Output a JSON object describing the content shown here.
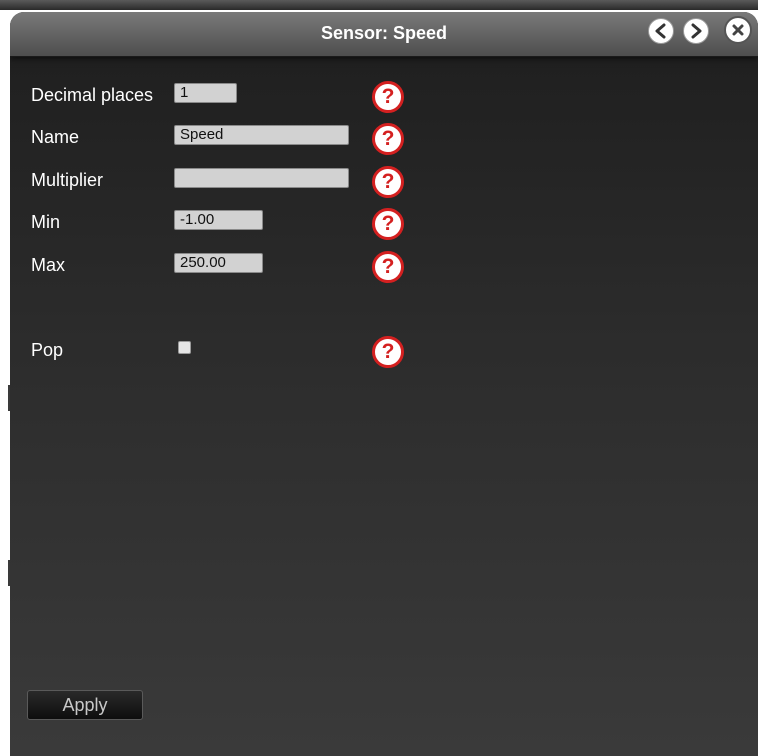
{
  "window": {
    "title": "Sensor: Speed",
    "nav": {
      "prev_icon": "chevron-left-icon",
      "next_icon": "chevron-right-icon",
      "close_icon": "close-icon"
    }
  },
  "form": {
    "decimal_places": {
      "label": "Decimal places",
      "value": "1"
    },
    "name": {
      "label": "Name",
      "value": "Speed"
    },
    "multiplier": {
      "label": "Multiplier",
      "value": ""
    },
    "min": {
      "label": "Min",
      "value": "-1.00"
    },
    "max": {
      "label": "Max",
      "value": "250.00"
    },
    "pop": {
      "label": "Pop",
      "checked": false
    },
    "help_glyph": "?"
  },
  "actions": {
    "apply_label": "Apply"
  },
  "colors": {
    "help_accent": "#d42020",
    "titlebar_top": "#7a7a7a",
    "titlebar_bottom": "#4e4e4e",
    "panel_bg": "#2c2c2c"
  }
}
